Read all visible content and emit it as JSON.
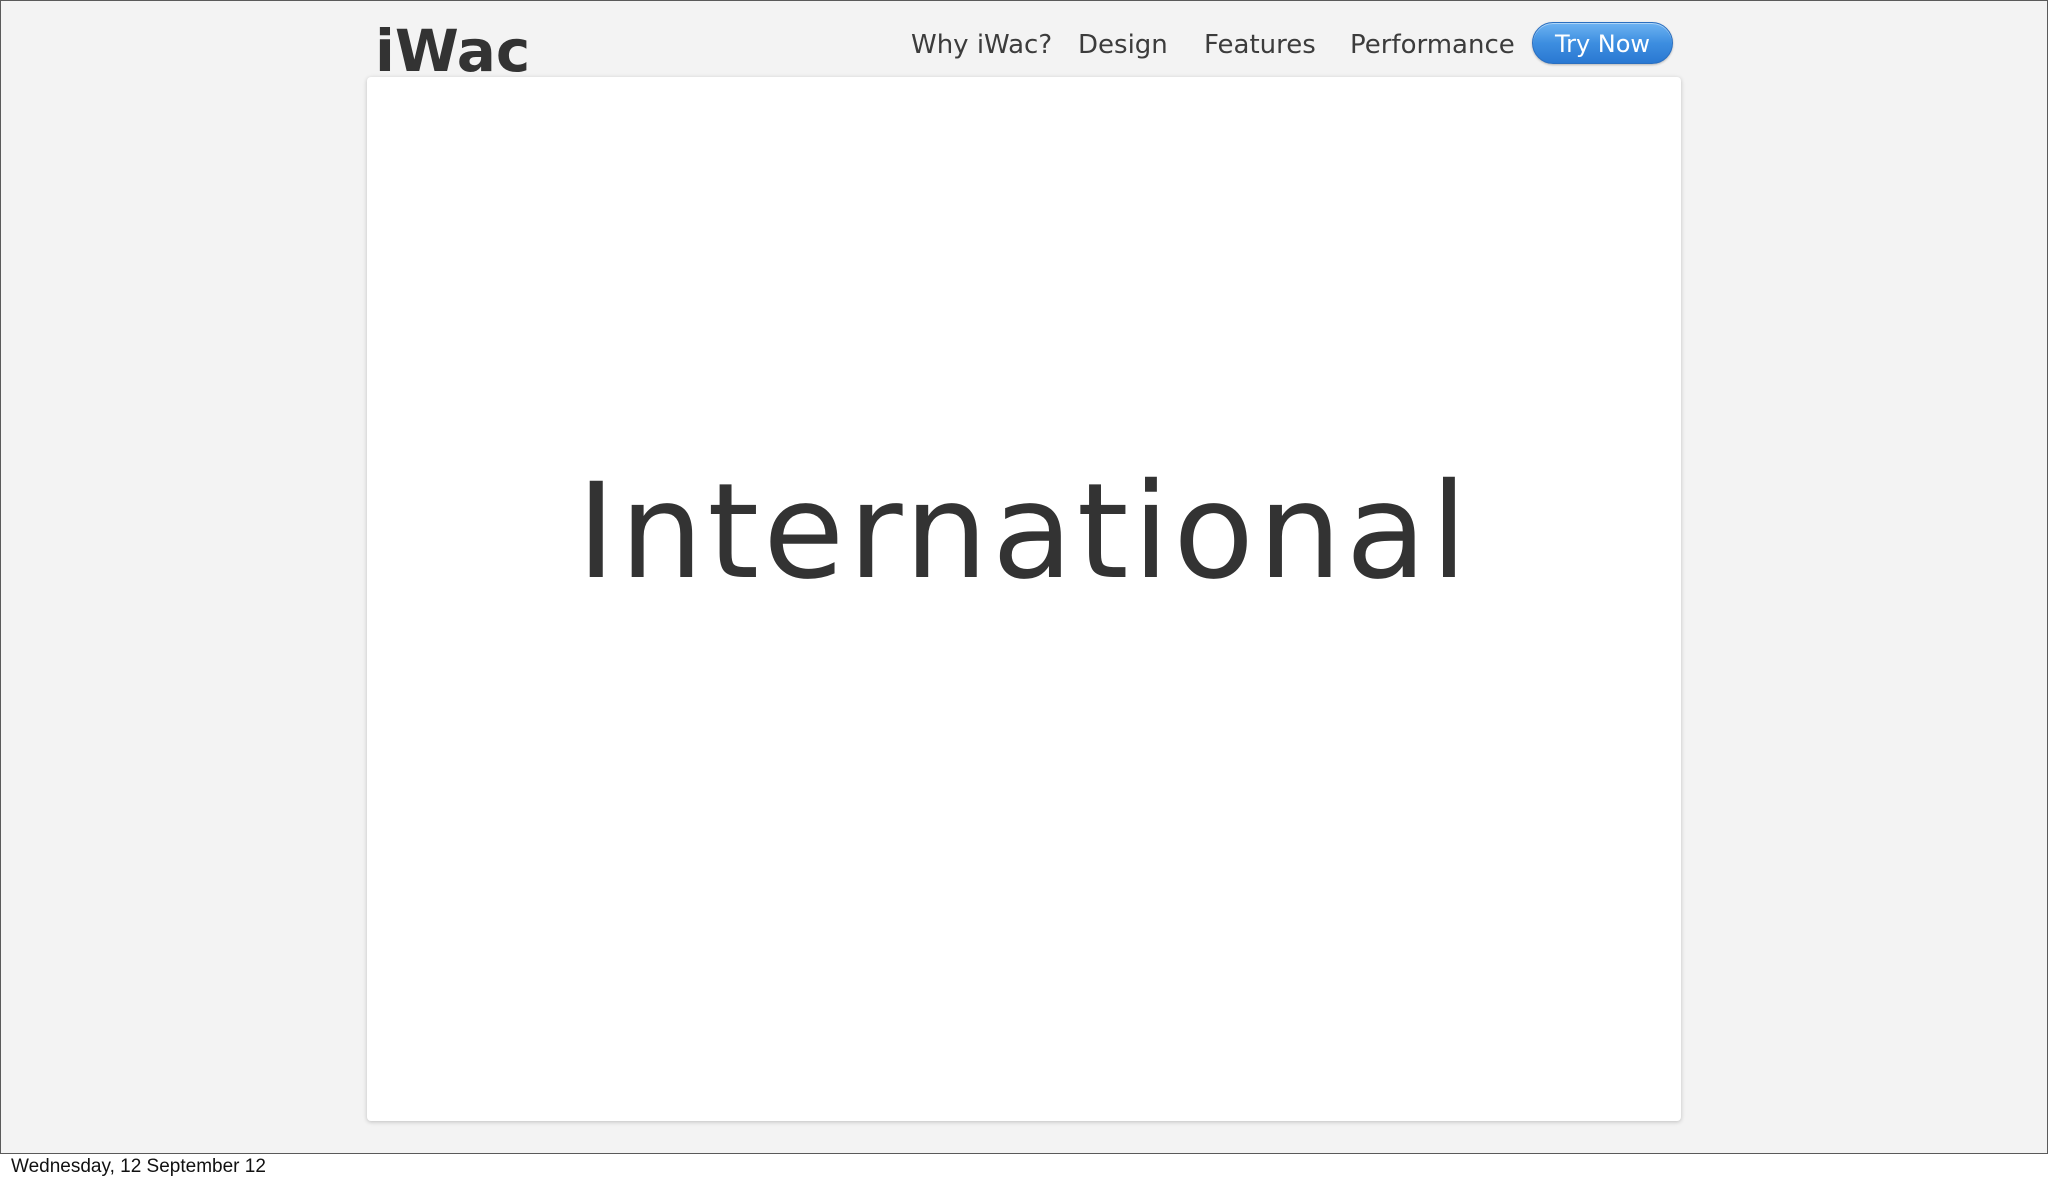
{
  "header": {
    "logo": "iWac",
    "nav": {
      "why": "Why iWac?",
      "design": "Design",
      "features": "Features",
      "performance": "Performance"
    },
    "cta_label": "Try Now"
  },
  "main": {
    "headline": "International"
  },
  "footer": {
    "date": "Wednesday, 12 September 12"
  },
  "colors": {
    "background": "#f3f3f3",
    "card": "#ffffff",
    "text": "#333333",
    "cta": "#3d8ee0"
  }
}
